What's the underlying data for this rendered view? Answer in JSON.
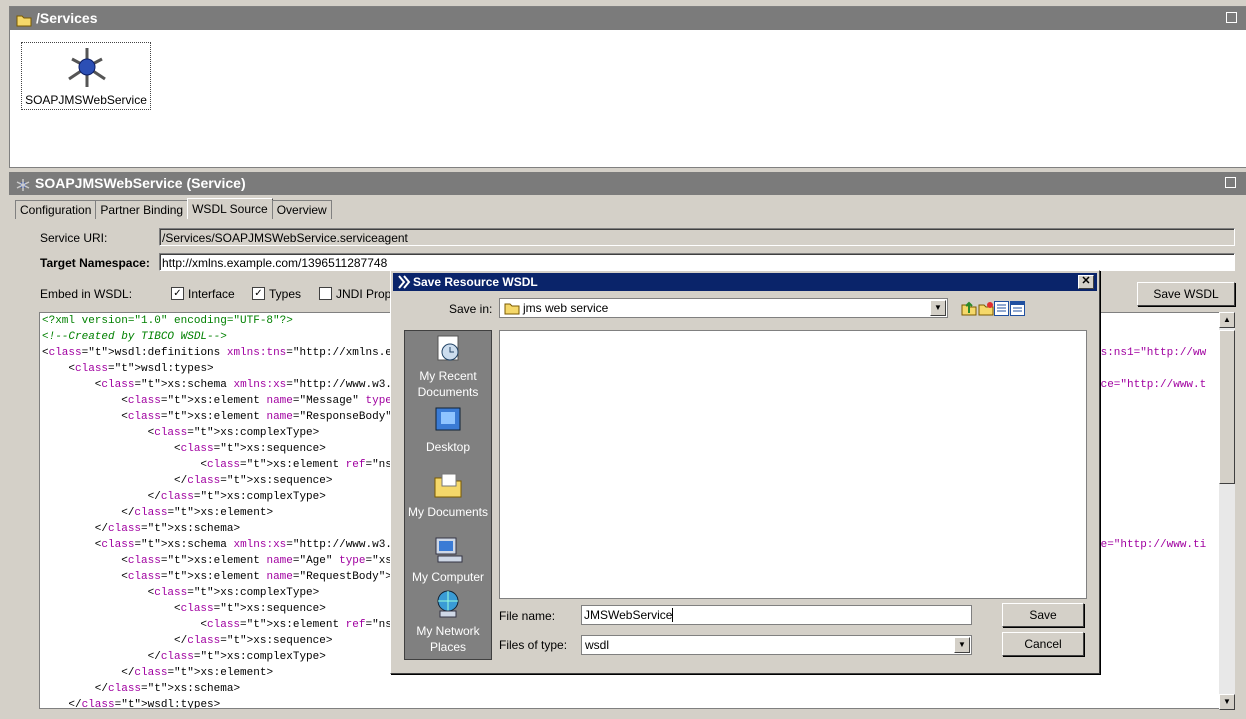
{
  "services_panel": {
    "title": "/Services",
    "node_label": "SOAPJMSWebService"
  },
  "detail_panel": {
    "title": "SOAPJMSWebService (Service)",
    "tabs": [
      "Configuration",
      "Partner Binding",
      "WSDL Source",
      "Overview"
    ],
    "active_tab": "WSDL Source",
    "service_uri_label": "Service URI:",
    "service_uri_value": "/Services/SOAPJMSWebService.serviceagent",
    "target_ns_label": "Target Namespace:",
    "target_ns_value": "http://xmlns.example.com/1396511287748",
    "embed_label": "Embed in WSDL:",
    "embed_interface": "Interface",
    "embed_types": "Types",
    "embed_jndi": "JNDI Prop",
    "save_wsdl_button": "Save WSDL",
    "right_tail": {
      "l2": "ns:ns1=\"http://ww",
      "l4": "ace=\"http://www.t",
      "l15": "ce=\"http://www.ti"
    }
  },
  "dialog": {
    "title": "Save Resource WSDL",
    "close": "✕",
    "save_in_label": "Save in:",
    "save_in_value": "jms web service",
    "places": [
      "My Recent Documents",
      "Desktop",
      "My Documents",
      "My Computer",
      "My Network Places"
    ],
    "file_name_label": "File name:",
    "file_name_value": "JMSWebService",
    "files_of_type_label": "Files of type:",
    "files_of_type_value": "wsdl",
    "save_button": "Save",
    "cancel_button": "Cancel"
  },
  "code_lines": [
    "<?xml version=\"1.0\" encoding=\"UTF-8\"?>",
    "<!--Created by TIBCO WSDL-->",
    "<wsdl:definitions xmlns:tns=\"http://xmlns.example.",
    "    <wsdl:types>",
    "        <xs:schema xmlns:xs=\"http://www.w3.org/200",
    "            <xs:element name=\"Message\" type=\"xs:st",
    "            <xs:element name=\"ResponseBody\">",
    "                <xs:complexType>",
    "                    <xs:sequence>",
    "                        <xs:element ref=\"ns1:Messa",
    "                    </xs:sequence>",
    "                </xs:complexType>",
    "            </xs:element>",
    "        </xs:schema>",
    "        <xs:schema xmlns:xs=\"http://www.w3.org/200",
    "            <xs:element name=\"Age\" type=\"xs:int\"/>",
    "            <xs:element name=\"RequestBody\">",
    "                <xs:complexType>",
    "                    <xs:sequence>",
    "                        <xs:element ref=\"ns0:Age\"/",
    "                    </xs:sequence>",
    "                </xs:complexType>",
    "            </xs:element>",
    "        </xs:schema>",
    "    </wsdl:types>"
  ],
  "icons": {
    "folder": "folder-icon",
    "service": "service-node-icon"
  }
}
